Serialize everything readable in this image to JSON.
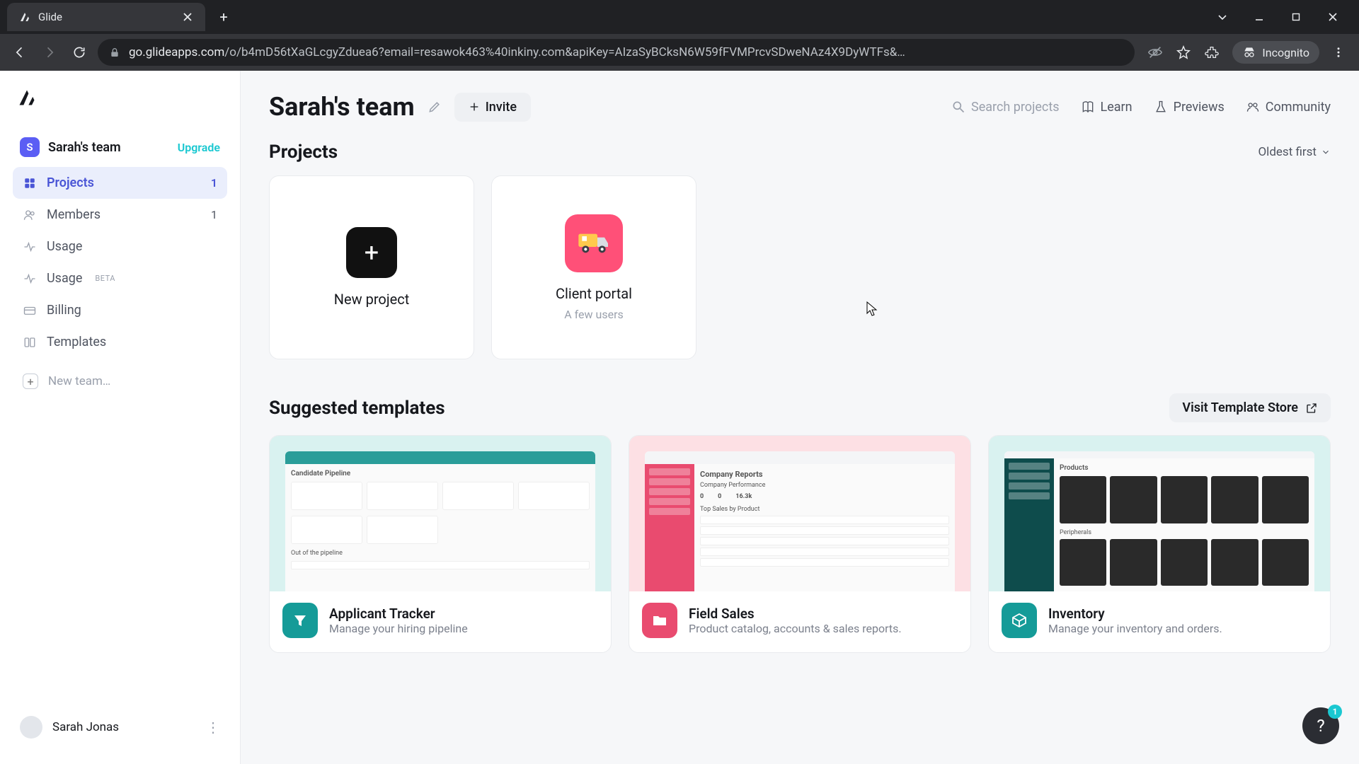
{
  "browser": {
    "tab_title": "Glide",
    "url_host": "go.glideapps.com",
    "url_path": "/o/b4mD56tXaGLcgyZduea6?email=resawok463%40inkiny.com&apiKey=AIzaSyBCksN6W59fFVMPrcvSDweNAz4X9DyWTFs&…",
    "incognito_label": "Incognito"
  },
  "sidebar": {
    "team_initial": "S",
    "team_name": "Sarah's team",
    "upgrade_label": "Upgrade",
    "items": [
      {
        "label": "Projects",
        "count": "1"
      },
      {
        "label": "Members",
        "count": "1"
      },
      {
        "label": "Usage",
        "count": ""
      },
      {
        "label": "Usage",
        "beta": "BETA",
        "count": ""
      },
      {
        "label": "Billing",
        "count": ""
      },
      {
        "label": "Templates",
        "count": ""
      }
    ],
    "new_team_label": "New team…",
    "user_name": "Sarah Jonas"
  },
  "header": {
    "title": "Sarah's team",
    "invite_label": "Invite",
    "search_placeholder": "Search projects",
    "learn_label": "Learn",
    "previews_label": "Previews",
    "community_label": "Community"
  },
  "projects": {
    "section_title": "Projects",
    "sort_label": "Oldest first",
    "new_project_label": "New project",
    "items": [
      {
        "name": "Client portal",
        "sub": "A few users"
      }
    ]
  },
  "templates": {
    "section_title": "Suggested templates",
    "visit_store_label": "Visit Template Store",
    "items": [
      {
        "name": "Applicant Tracker",
        "desc": "Manage your hiring pipeline"
      },
      {
        "name": "Field Sales",
        "desc": "Product catalog, accounts & sales reports."
      },
      {
        "name": "Inventory",
        "desc": "Manage your inventory and orders."
      }
    ]
  },
  "help": {
    "badge": "1"
  }
}
